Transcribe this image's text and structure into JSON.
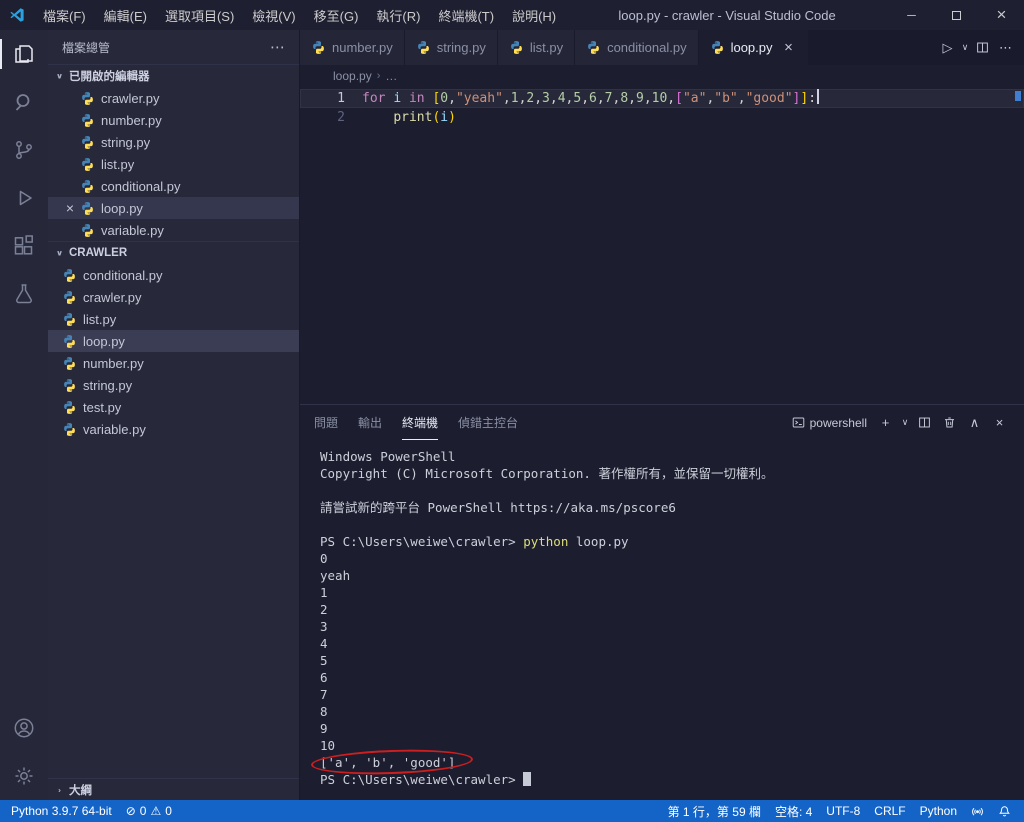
{
  "titlebar": {
    "title": "loop.py - crawler - Visual Studio Code",
    "menus": [
      {
        "key": "file",
        "label": "檔案(F)"
      },
      {
        "key": "edit",
        "label": "編輯(E)"
      },
      {
        "key": "selection",
        "label": "選取項目(S)"
      },
      {
        "key": "view",
        "label": "檢視(V)"
      },
      {
        "key": "go",
        "label": "移至(G)"
      },
      {
        "key": "run",
        "label": "執行(R)"
      },
      {
        "key": "terminal",
        "label": "終端機(T)"
      },
      {
        "key": "help",
        "label": "說明(H)"
      }
    ]
  },
  "activitybar": {
    "top": [
      {
        "name": "explorer",
        "active": true
      },
      {
        "name": "search",
        "active": false
      },
      {
        "name": "source-control",
        "active": false
      },
      {
        "name": "run-debug",
        "active": false
      },
      {
        "name": "extensions",
        "active": false
      },
      {
        "name": "testing",
        "active": false
      }
    ],
    "bottom": [
      {
        "name": "account",
        "active": false
      },
      {
        "name": "settings",
        "active": false
      }
    ]
  },
  "sidebar": {
    "title": "檔案總管",
    "open_editors": {
      "label": "已開啟的編輯器",
      "items": [
        {
          "name": "crawler.py",
          "active": false
        },
        {
          "name": "number.py",
          "active": false
        },
        {
          "name": "string.py",
          "active": false
        },
        {
          "name": "list.py",
          "active": false
        },
        {
          "name": "conditional.py",
          "active": false
        },
        {
          "name": "loop.py",
          "active": true
        },
        {
          "name": "variable.py",
          "active": false
        }
      ]
    },
    "workspace": {
      "label": "CRAWLER",
      "items": [
        {
          "name": "conditional.py",
          "selected": false
        },
        {
          "name": "crawler.py",
          "selected": false
        },
        {
          "name": "list.py",
          "selected": false
        },
        {
          "name": "loop.py",
          "selected": true
        },
        {
          "name": "number.py",
          "selected": false
        },
        {
          "name": "string.py",
          "selected": false
        },
        {
          "name": "test.py",
          "selected": false
        },
        {
          "name": "variable.py",
          "selected": false
        }
      ]
    },
    "outline_label": "大綱"
  },
  "editor": {
    "tabs": [
      {
        "name": "number.py",
        "active": false
      },
      {
        "name": "string.py",
        "active": false
      },
      {
        "name": "list.py",
        "active": false
      },
      {
        "name": "conditional.py",
        "active": false
      },
      {
        "name": "loop.py",
        "active": true
      }
    ],
    "breadcrumb": {
      "file": "loop.py",
      "more": "…"
    },
    "code_lines": [
      {
        "number": "1",
        "active": true,
        "cursor": true,
        "tokens": [
          {
            "c": "kw",
            "t": "for"
          },
          {
            "c": "pl",
            "t": " "
          },
          {
            "c": "var",
            "t": "i"
          },
          {
            "c": "pl",
            "t": " "
          },
          {
            "c": "kw",
            "t": "in"
          },
          {
            "c": "pl",
            "t": " "
          },
          {
            "c": "b1",
            "t": "["
          },
          {
            "c": "num",
            "t": "0"
          },
          {
            "c": "pl",
            "t": ","
          },
          {
            "c": "str",
            "t": "\"yeah\""
          },
          {
            "c": "pl",
            "t": ","
          },
          {
            "c": "num",
            "t": "1"
          },
          {
            "c": "pl",
            "t": ","
          },
          {
            "c": "num",
            "t": "2"
          },
          {
            "c": "pl",
            "t": ","
          },
          {
            "c": "num",
            "t": "3"
          },
          {
            "c": "pl",
            "t": ","
          },
          {
            "c": "num",
            "t": "4"
          },
          {
            "c": "pl",
            "t": ","
          },
          {
            "c": "num",
            "t": "5"
          },
          {
            "c": "pl",
            "t": ","
          },
          {
            "c": "num",
            "t": "6"
          },
          {
            "c": "pl",
            "t": ","
          },
          {
            "c": "num",
            "t": "7"
          },
          {
            "c": "pl",
            "t": ","
          },
          {
            "c": "num",
            "t": "8"
          },
          {
            "c": "pl",
            "t": ","
          },
          {
            "c": "num",
            "t": "9"
          },
          {
            "c": "pl",
            "t": ","
          },
          {
            "c": "num",
            "t": "10"
          },
          {
            "c": "pl",
            "t": ","
          },
          {
            "c": "b2",
            "t": "["
          },
          {
            "c": "str",
            "t": "\"a\""
          },
          {
            "c": "pl",
            "t": ","
          },
          {
            "c": "str",
            "t": "\"b\""
          },
          {
            "c": "pl",
            "t": ","
          },
          {
            "c": "str",
            "t": "\"good\""
          },
          {
            "c": "b2",
            "t": "]"
          },
          {
            "c": "b1",
            "t": "]"
          },
          {
            "c": "pl",
            "t": ":"
          }
        ]
      },
      {
        "number": "2",
        "active": false,
        "cursor": false,
        "tokens": [
          {
            "c": "pl",
            "t": "    "
          },
          {
            "c": "fn",
            "t": "print"
          },
          {
            "c": "b1",
            "t": "("
          },
          {
            "c": "var",
            "t": "i"
          },
          {
            "c": "b1",
            "t": ")"
          }
        ]
      }
    ]
  },
  "panel": {
    "tabs": [
      {
        "key": "problems",
        "label": "問題",
        "active": false
      },
      {
        "key": "output",
        "label": "輸出",
        "active": false
      },
      {
        "key": "terminal",
        "label": "終端機",
        "active": true
      },
      {
        "key": "debug-console",
        "label": "偵錯主控台",
        "active": false
      }
    ],
    "shell_label": "powershell"
  },
  "terminal": {
    "annotation_color": "#cc1f1f",
    "lines": [
      {
        "segments": [
          {
            "c": "pl",
            "t": "Windows PowerShell"
          }
        ]
      },
      {
        "segments": [
          {
            "c": "pl",
            "t": "Copyright (C) Microsoft Corporation. 著作權所有，並保留一切權利。"
          }
        ]
      },
      {
        "segments": []
      },
      {
        "segments": [
          {
            "c": "pl",
            "t": "請嘗試新的跨平台 PowerShell https://aka.ms/pscore6"
          }
        ]
      },
      {
        "segments": []
      },
      {
        "segments": [
          {
            "c": "pl",
            "t": "PS C:\\Users\\weiwe\\crawler> "
          },
          {
            "c": "cmd",
            "t": "python"
          },
          {
            "c": "pl",
            "t": " loop.py"
          }
        ]
      },
      {
        "segments": [
          {
            "c": "pl",
            "t": "0"
          }
        ]
      },
      {
        "segments": [
          {
            "c": "pl",
            "t": "yeah"
          }
        ]
      },
      {
        "segments": [
          {
            "c": "pl",
            "t": "1"
          }
        ]
      },
      {
        "segments": [
          {
            "c": "pl",
            "t": "2"
          }
        ]
      },
      {
        "segments": [
          {
            "c": "pl",
            "t": "3"
          }
        ]
      },
      {
        "segments": [
          {
            "c": "pl",
            "t": "4"
          }
        ]
      },
      {
        "segments": [
          {
            "c": "pl",
            "t": "5"
          }
        ]
      },
      {
        "segments": [
          {
            "c": "pl",
            "t": "6"
          }
        ]
      },
      {
        "segments": [
          {
            "c": "pl",
            "t": "7"
          }
        ]
      },
      {
        "segments": [
          {
            "c": "pl",
            "t": "8"
          }
        ]
      },
      {
        "segments": [
          {
            "c": "pl",
            "t": "9"
          }
        ]
      },
      {
        "segments": [
          {
            "c": "pl",
            "t": "10"
          }
        ]
      },
      {
        "circled": true,
        "segments": [
          {
            "c": "pl",
            "t": "['a', 'b', 'good']"
          }
        ]
      },
      {
        "cursor": true,
        "segments": [
          {
            "c": "pl",
            "t": "PS C:\\Users\\weiwe\\crawler> "
          }
        ]
      }
    ]
  },
  "statusbar": {
    "python_version": "Python 3.9.7 64-bit",
    "problems": {
      "errors": "0",
      "warnings": "0"
    },
    "right_items": [
      {
        "key": "cursor-position",
        "label": "第 1 行，第 59 欄"
      },
      {
        "key": "indentation",
        "label": "空格: 4"
      },
      {
        "key": "encoding",
        "label": "UTF-8"
      },
      {
        "key": "eol",
        "label": "CRLF"
      },
      {
        "key": "language-mode",
        "label": "Python"
      }
    ]
  },
  "glyphs": {
    "run": "▷",
    "chevron_down": "∨",
    "chevron_up": "∧",
    "more": "⋯",
    "plus": "+",
    "close": "×",
    "minimize": "─",
    "error": "⊘",
    "warning": "⚠"
  }
}
